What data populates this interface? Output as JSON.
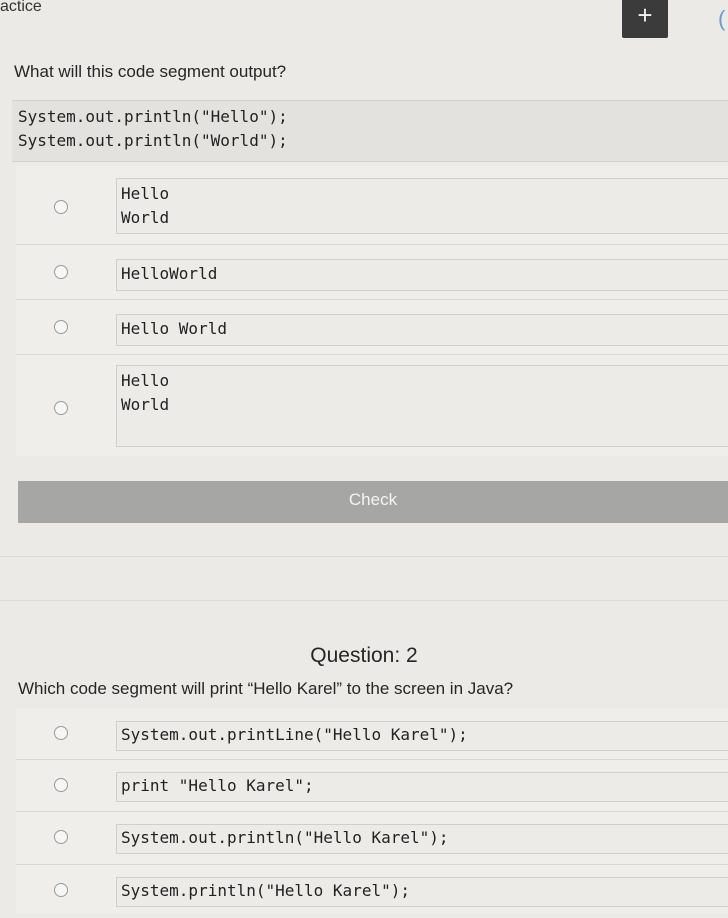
{
  "header": {
    "title": "actice",
    "plus_label": "+",
    "edge_glyph": "("
  },
  "question1": {
    "prompt": "What will this code segment output?",
    "code": [
      "System.out.println(\"Hello\");",
      "System.out.println(\"World\");"
    ],
    "choices": [
      {
        "lines": [
          "Hello",
          "World"
        ]
      },
      {
        "lines": [
          "HelloWorld"
        ]
      },
      {
        "lines": [
          "Hello World"
        ]
      },
      {
        "lines": [
          "Hello",
          "",
          "World"
        ]
      }
    ],
    "check_label": "Check"
  },
  "question2": {
    "title": "Question: 2",
    "prompt": "Which code segment will print “Hello Karel” to the screen in Java?",
    "choices": [
      "System.out.printLine(\"Hello Karel\");",
      "print \"Hello Karel\";",
      "System.out.println(\"Hello Karel\");",
      "System.println(\"Hello Karel\");"
    ]
  }
}
